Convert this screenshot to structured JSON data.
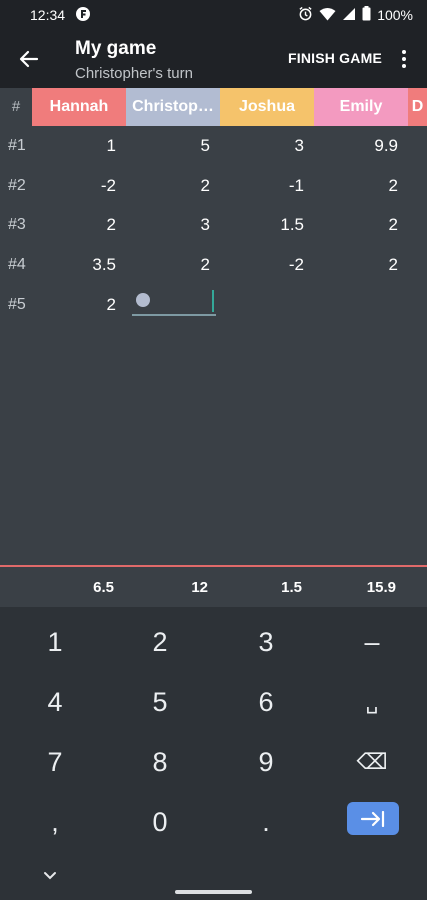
{
  "status_bar": {
    "time": "12:34",
    "battery": "100%"
  },
  "app_bar": {
    "title": "My game",
    "subtitle": "Christopher's turn",
    "finish_label": "FINISH GAME"
  },
  "table": {
    "hash_label": "#",
    "players": [
      {
        "name": "Hannah",
        "color": "#f07c7c"
      },
      {
        "name": "Christop…",
        "color": "#b2bcd2"
      },
      {
        "name": "Joshua",
        "color": "#f5c36b"
      },
      {
        "name": "Emily",
        "color": "#f39ac0"
      },
      {
        "name": "D",
        "color": "#f07c7c"
      }
    ],
    "rows": [
      {
        "label": "#1",
        "values": [
          "1",
          "5",
          "3",
          "9.9"
        ]
      },
      {
        "label": "#2",
        "values": [
          "-2",
          "2",
          "-1",
          "2"
        ]
      },
      {
        "label": "#3",
        "values": [
          "2",
          "3",
          "1.5",
          "2"
        ]
      },
      {
        "label": "#4",
        "values": [
          "3.5",
          "2",
          "-2",
          "2"
        ]
      },
      {
        "label": "#5",
        "values": [
          "2",
          "",
          "",
          ""
        ]
      }
    ],
    "totals": [
      "6.5",
      "12",
      "1.5",
      "15.9"
    ]
  },
  "keyboard": {
    "keys": [
      "1",
      "2",
      "3",
      "–",
      "4",
      "5",
      "6",
      "␣",
      "7",
      "8",
      "9",
      "⌫",
      ",",
      "0",
      "."
    ]
  }
}
